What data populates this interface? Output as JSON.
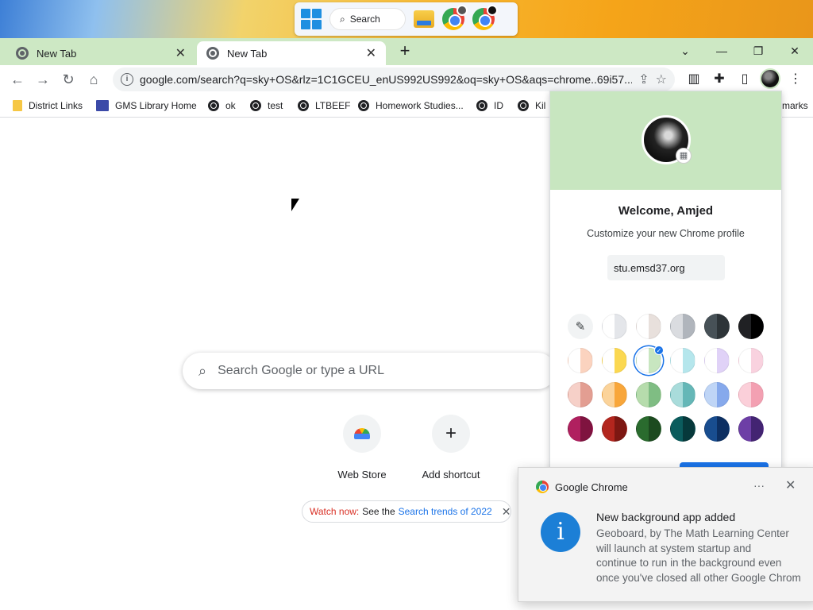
{
  "taskbar": {
    "search_label": "Search"
  },
  "tabs": [
    {
      "title": "New Tab",
      "close": "✕"
    },
    {
      "title": "New Tab",
      "close": "✕"
    }
  ],
  "toolbar": {
    "url_host": "google.com",
    "url_rest": "/search?q=sky+OS&rlz=1C1GCEU_enUS992US992&oq=sky+OS&aqs=chrome..69i57..."
  },
  "bookmarks": [
    {
      "label": "District Links",
      "icon": "folder-icon"
    },
    {
      "label": "GMS Library Home",
      "icon": "gms-icon"
    },
    {
      "label": "ok",
      "icon": "globe-icon"
    },
    {
      "label": "test",
      "icon": "globe-icon"
    },
    {
      "label": "LTBEEF",
      "icon": "globe-icon"
    },
    {
      "label": "Homework Studies...",
      "icon": "globe-icon"
    },
    {
      "label": "ID",
      "icon": "globe-icon"
    },
    {
      "label": "Kil",
      "icon": "globe-icon"
    }
  ],
  "bookmarks_overflow": "marks",
  "ntp": {
    "search_placeholder": "Search Google or type a URL",
    "shortcuts": [
      {
        "label": "Web Store",
        "icon": "web-store-icon"
      },
      {
        "label": "Add shortcut",
        "icon": "plus-icon"
      }
    ],
    "promo": {
      "prefix": "Watch now:",
      "middle": "See the",
      "link": "Search trends of 2022"
    }
  },
  "profile": {
    "welcome": "Welcome, Amjed",
    "subtitle": "Customize your new Chrome profile",
    "domain": "stu.emsd37.org",
    "selected_swatch": 8,
    "swatches": [
      {
        "left": "#f1f3f4",
        "right": "#f1f3f4",
        "picker": true
      },
      {
        "left": "#ffffff",
        "right": "#e4e6ea"
      },
      {
        "left": "#ffffff",
        "right": "#e8e0dc"
      },
      {
        "left": "#dadce0",
        "right": "#b0b5bc"
      },
      {
        "left": "#475157",
        "right": "#2d3438"
      },
      {
        "left": "#202124",
        "right": "#000000"
      },
      {
        "left": "#ffffff",
        "right": "#fbd3bf"
      },
      {
        "left": "#ffffff",
        "right": "#fbd851"
      },
      {
        "left": "#ffffff",
        "right": "#c8e6c0"
      },
      {
        "left": "#ffffff",
        "right": "#b5e6ec"
      },
      {
        "left": "#ffffff",
        "right": "#e0d2f7"
      },
      {
        "left": "#ffffff",
        "right": "#f9d2df"
      },
      {
        "left": "#f6d0c8",
        "right": "#e39e92"
      },
      {
        "left": "#fbd39a",
        "right": "#f8a63a"
      },
      {
        "left": "#b6dcac",
        "right": "#7fbd83"
      },
      {
        "left": "#a9dcdb",
        "right": "#65b7b7"
      },
      {
        "left": "#bfd5f6",
        "right": "#86a9ec"
      },
      {
        "left": "#fbcfd9",
        "right": "#f3a0b2"
      },
      {
        "left": "#b0205f",
        "right": "#7f133f"
      },
      {
        "left": "#b3261e",
        "right": "#7d1712"
      },
      {
        "left": "#2a6b2e",
        "right": "#1c4a1f"
      },
      {
        "left": "#0b5c5d",
        "right": "#06393b"
      },
      {
        "left": "#184d8f",
        "right": "#0c2f62"
      },
      {
        "left": "#6d3fa6",
        "right": "#432472"
      }
    ]
  },
  "notification": {
    "app": "Google Chrome",
    "title": "New background app added",
    "body_lines": [
      "Geoboard, by The Math Learning Center",
      "will launch at system startup and",
      "continue to run in the background even",
      "once you've closed all other Google Chrome"
    ]
  }
}
